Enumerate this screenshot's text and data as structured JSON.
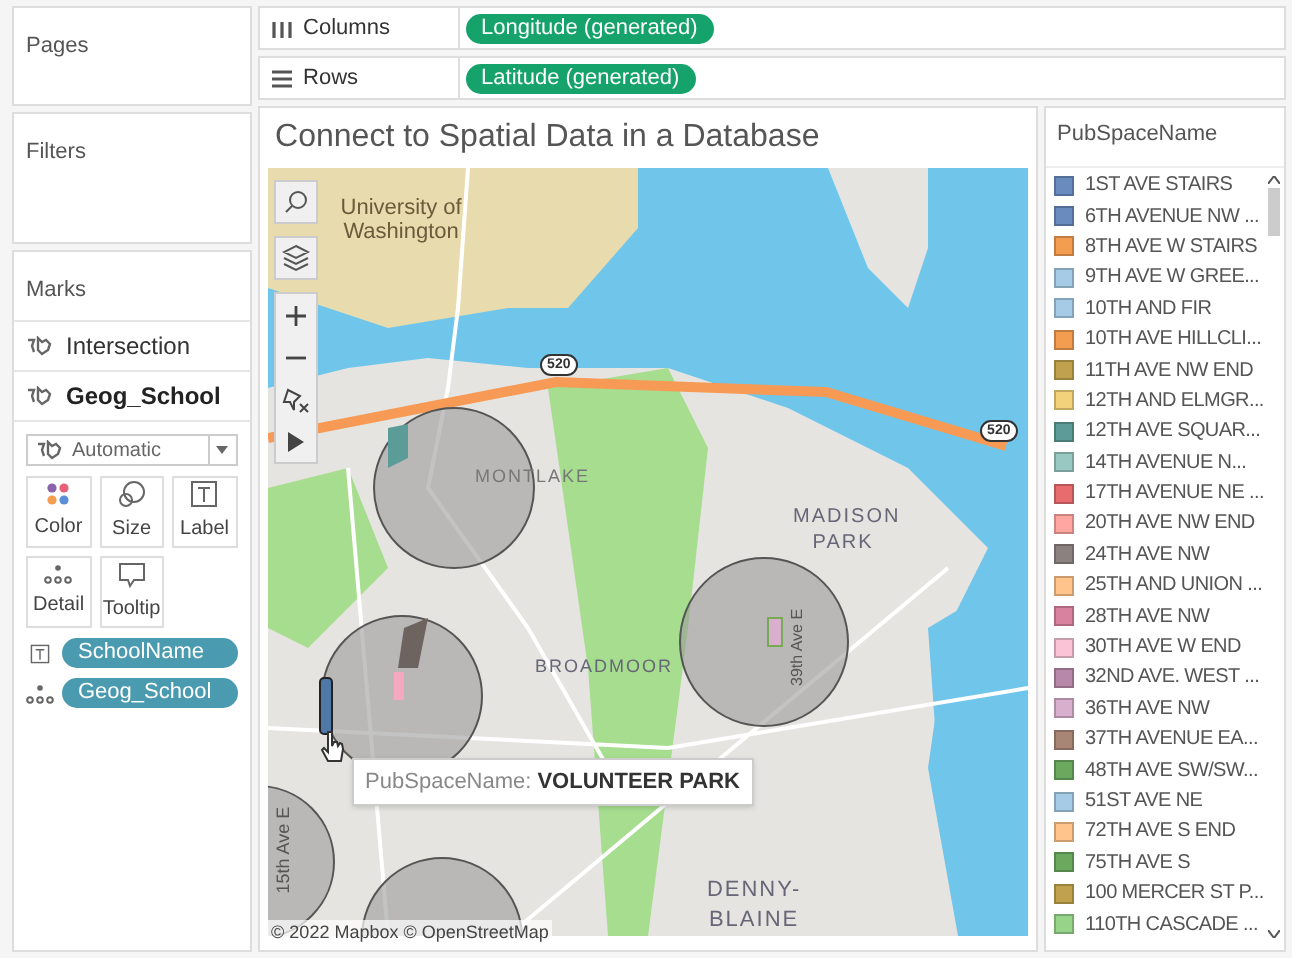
{
  "pages": {
    "title": "Pages"
  },
  "filters": {
    "title": "Filters"
  },
  "marks": {
    "title": "Marks",
    "layers": [
      {
        "label": "Intersection",
        "selected": false
      },
      {
        "label": "Geog_School",
        "selected": true
      }
    ],
    "mark_type": "Automatic",
    "cards": [
      {
        "kind": "color",
        "label": "Color"
      },
      {
        "kind": "size",
        "label": "Size"
      },
      {
        "kind": "label",
        "label": "Label"
      },
      {
        "kind": "detail",
        "label": "Detail"
      },
      {
        "kind": "tooltip",
        "label": "Tooltip"
      }
    ],
    "pills": [
      {
        "kind": "label",
        "label": "SchoolName"
      },
      {
        "kind": "detail",
        "label": "Geog_School"
      }
    ]
  },
  "shelves": [
    {
      "kind": "columns",
      "label": "Columns",
      "pill": "Longitude (generated)"
    },
    {
      "kind": "rows",
      "label": "Rows",
      "pill": "Latitude (generated)"
    }
  ],
  "view": {
    "title": "Connect to Spatial Data in a Database",
    "map_labels": [
      "University of Washington",
      "MONTLAKE",
      "BROADMOOR",
      "MADISON PARK",
      "DENNY-BLAINE",
      "15th Ave E",
      "39th Ave E",
      "520",
      "520"
    ],
    "attribution": "© 2022 Mapbox © OpenStreetMap",
    "tooltip": {
      "field": "PubSpaceName:",
      "value": "VOLUNTEER PARK"
    }
  },
  "legend": {
    "title": "PubSpaceName",
    "items": [
      {
        "label": "1ST AVE STAIRS",
        "color": "#6a8bbd"
      },
      {
        "label": "6TH AVENUE NW ...",
        "color": "#6a8bbd"
      },
      {
        "label": "8TH AVE W STAIRS",
        "color": "#f29d4f"
      },
      {
        "label": "9TH AVE W GREE...",
        "color": "#a6cbe6"
      },
      {
        "label": "10TH AND FIR",
        "color": "#a6cbe6"
      },
      {
        "label": "10TH AVE HILLCLI...",
        "color": "#f29d4f"
      },
      {
        "label": "11TH AVE NW END",
        "color": "#c0a24e"
      },
      {
        "label": "12TH AND ELMGR...",
        "color": "#f2d27a"
      },
      {
        "label": "12TH AVE SQUAR...",
        "color": "#5c9c98"
      },
      {
        "label": "14TH AVENUE N...",
        "color": "#99c8c2"
      },
      {
        "label": "17TH AVENUE NE ...",
        "color": "#e86c6e"
      },
      {
        "label": "20TH AVE NW END",
        "color": "#ffa6a3"
      },
      {
        "label": "24TH AVE NW",
        "color": "#8b8280"
      },
      {
        "label": "25TH AND UNION ...",
        "color": "#ffc48c"
      },
      {
        "label": "28TH AVE NW",
        "color": "#d9829f"
      },
      {
        "label": "30TH AVE W END",
        "color": "#fac4d6"
      },
      {
        "label": "32ND AVE. WEST ...",
        "color": "#b888ab"
      },
      {
        "label": "36TH AVE NW",
        "color": "#d8b0cd"
      },
      {
        "label": "37TH AVENUE EA...",
        "color": "#a88574"
      },
      {
        "label": "48TH AVE SW/SW...",
        "color": "#6aa95e"
      },
      {
        "label": "51ST AVE NE",
        "color": "#a6cbe6"
      },
      {
        "label": "72TH AVE S END",
        "color": "#ffc48c"
      },
      {
        "label": "75TH AVE S",
        "color": "#6aa95e"
      },
      {
        "label": "100 MERCER ST P...",
        "color": "#c0a24e"
      },
      {
        "label": "110TH CASCADE ...",
        "color": "#96d48a"
      }
    ]
  }
}
